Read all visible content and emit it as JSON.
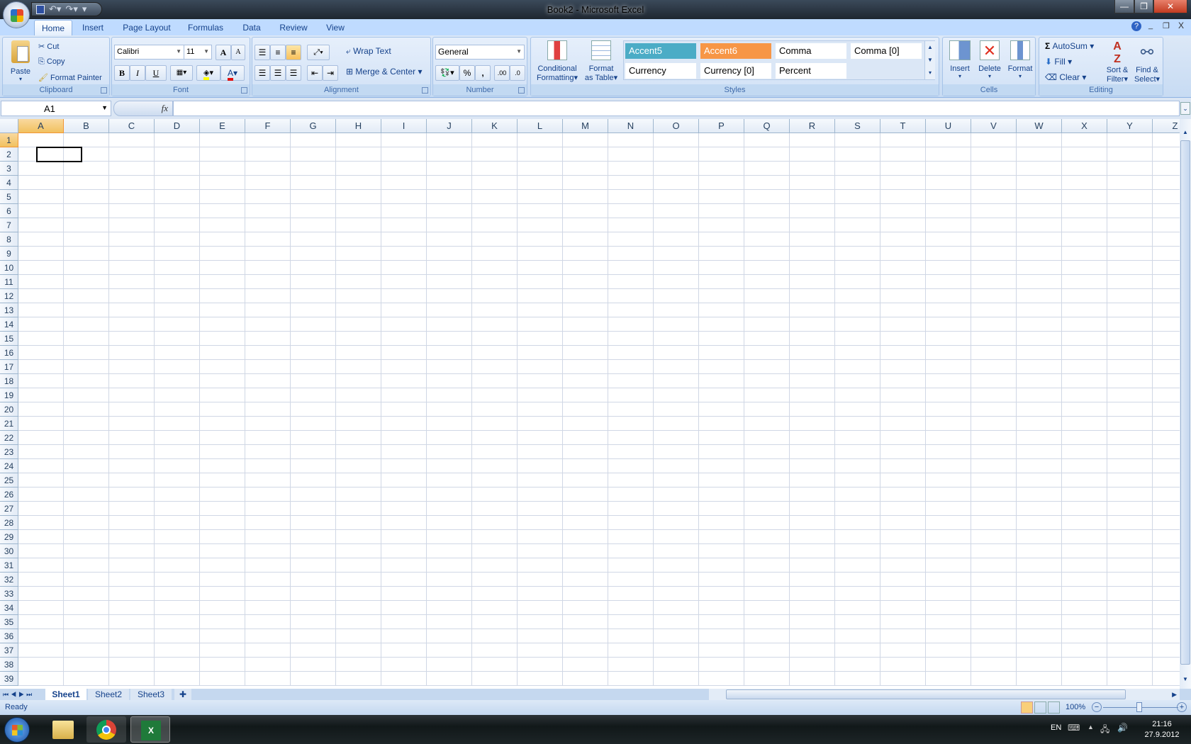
{
  "window": {
    "title": "Book2 - Microsoft Excel"
  },
  "qat": {
    "save": "save-icon",
    "undo": "undo-icon",
    "redo": "redo-icon",
    "customize": "▾"
  },
  "tabs": [
    "Home",
    "Insert",
    "Page Layout",
    "Formulas",
    "Data",
    "Review",
    "View"
  ],
  "clipboard": {
    "label": "Clipboard",
    "paste": "Paste",
    "cut": "Cut",
    "copy": "Copy",
    "format_painter": "Format Painter"
  },
  "font": {
    "label": "Font",
    "name": "Calibri",
    "size": "11",
    "bold": "B",
    "italic": "I",
    "underline": "U",
    "grow": "A",
    "shrink": "A",
    "color_a": "A"
  },
  "alignment": {
    "label": "Alignment",
    "wrap": "Wrap Text",
    "merge": "Merge & Center"
  },
  "number": {
    "label": "Number",
    "format": "General",
    "percent": "%",
    "comma": ",",
    "inc": ".00",
    "dec": ".0"
  },
  "styles": {
    "label": "Styles",
    "conditional": [
      "Conditional",
      "Formatting"
    ],
    "format_table": [
      "Format",
      "as Table"
    ],
    "items": [
      {
        "name": "Accent5",
        "bg": "#4bacc6",
        "fg": "#ffffff"
      },
      {
        "name": "Accent6",
        "bg": "#f79646",
        "fg": "#ffffff"
      },
      {
        "name": "Comma",
        "bg": "#ffffff",
        "fg": "#000000"
      },
      {
        "name": "Comma [0]",
        "bg": "#ffffff",
        "fg": "#000000"
      },
      {
        "name": "Currency",
        "bg": "#ffffff",
        "fg": "#000000"
      },
      {
        "name": "Currency [0]",
        "bg": "#ffffff",
        "fg": "#000000"
      },
      {
        "name": "Percent",
        "bg": "#ffffff",
        "fg": "#000000"
      }
    ]
  },
  "cells": {
    "label": "Cells",
    "insert": "Insert",
    "delete": "Delete",
    "format": "Format"
  },
  "editing": {
    "label": "Editing",
    "autosum": "AutoSum",
    "fill": "Fill",
    "clear": "Clear",
    "sort": [
      "Sort &",
      "Filter"
    ],
    "find": [
      "Find &",
      "Select"
    ]
  },
  "formula_bar": {
    "name_box": "A1",
    "fx": "fx",
    "value": ""
  },
  "grid": {
    "columns": [
      "A",
      "B",
      "C",
      "D",
      "E",
      "F",
      "G",
      "H",
      "I",
      "J",
      "K",
      "L",
      "M",
      "N",
      "O",
      "P",
      "Q",
      "R",
      "S",
      "T",
      "U",
      "V",
      "W",
      "X",
      "Y",
      "Z"
    ],
    "row_count": 39,
    "active_cell": "A1"
  },
  "sheets": [
    "Sheet1",
    "Sheet2",
    "Sheet3"
  ],
  "active_sheet": "Sheet1",
  "status": {
    "text": "Ready",
    "zoom": "100%"
  },
  "taskbar": {
    "lang": "EN",
    "time": "21:16",
    "date": "27.9.2012"
  }
}
